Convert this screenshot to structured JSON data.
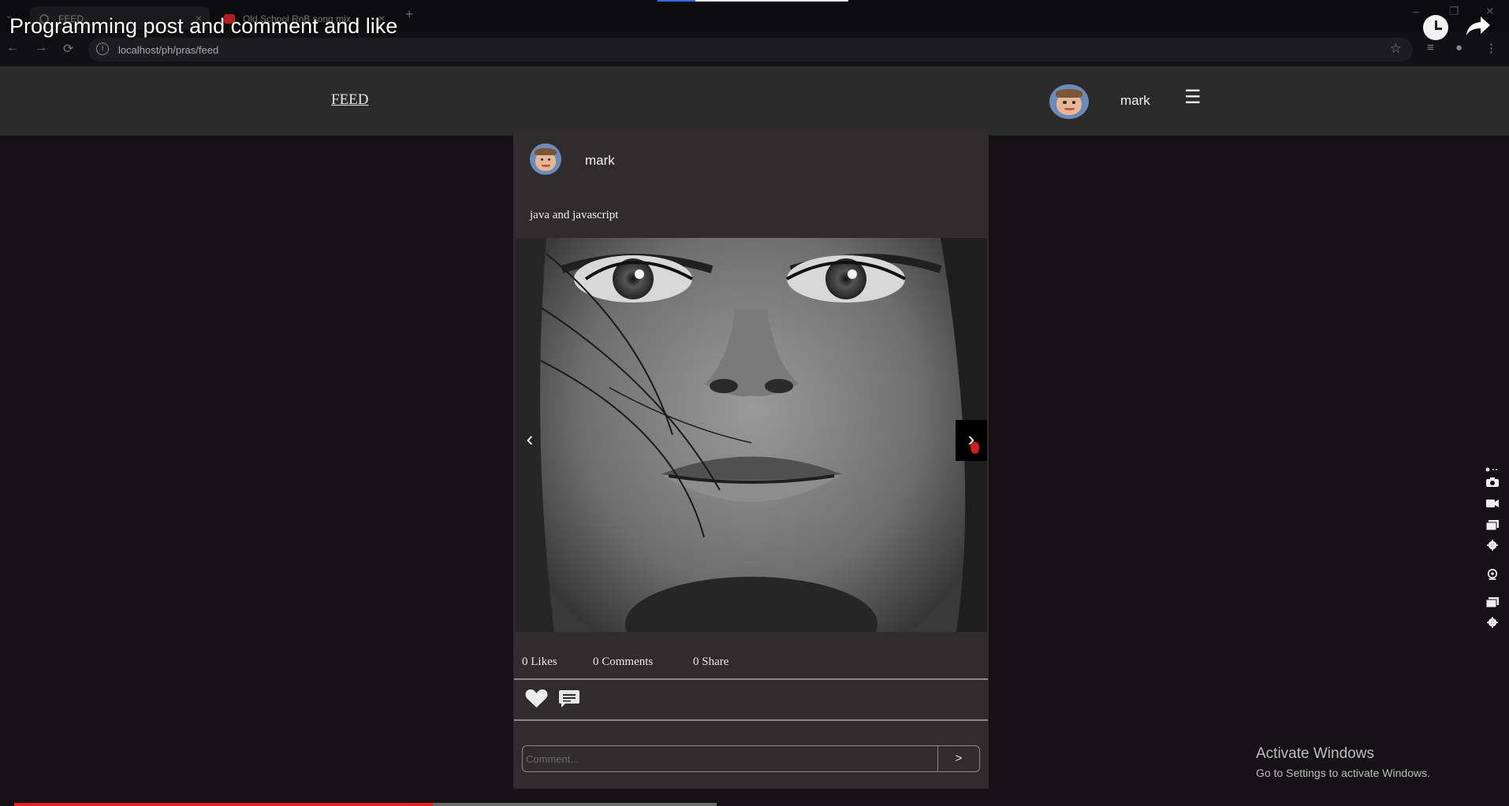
{
  "browser": {
    "tabs": [
      {
        "label": "FEED",
        "active": true
      },
      {
        "label": "Old School RnB song mix",
        "active": false
      }
    ],
    "new_tab": "+",
    "url": "localhost/ph/pras/feed",
    "nav": {
      "back": "←",
      "forward": "→",
      "reload": "⟳"
    }
  },
  "video_overlay": {
    "title": "Programming post and comment and like",
    "watch_later_icon": "clock-icon",
    "share_icon": "share-icon",
    "progress_played_fraction": 0.28,
    "progress_buffered_fraction": 0.47
  },
  "site": {
    "nav_link": "FEED",
    "user_name": "mark",
    "menu_glyph": "☰"
  },
  "post": {
    "author": "mark",
    "text": "java and javascript",
    "image_description_icon": "face-photo",
    "prev_glyph": "‹",
    "next_glyph": "›",
    "stats": {
      "likes": "0 Likes",
      "comments": "0 Comments",
      "shares": "0 Share"
    },
    "actions": {
      "like_icon": "heart-icon",
      "comment_icon": "comment-icon"
    },
    "comment_placeholder": "Comment...",
    "send_label": ">"
  },
  "watermark": {
    "title": "Activate Windows",
    "subtitle": "Go to Settings to activate Windows."
  },
  "colors": {
    "page_bg": "#141214",
    "header_bg": "#2c2b2c",
    "card_bg": "#2f2c2d",
    "progress_red": "#e52222"
  }
}
